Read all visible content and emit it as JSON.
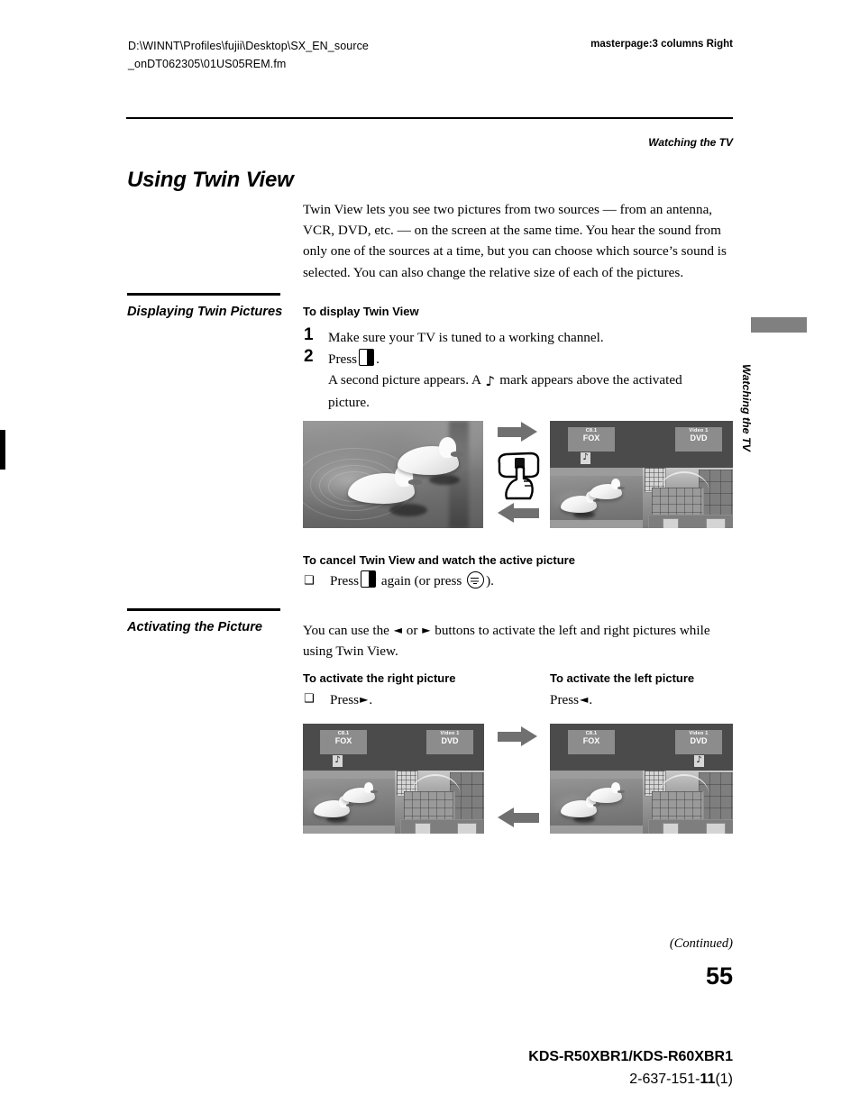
{
  "header": {
    "file_path": "D:\\WINNT\\Profiles\\fujii\\Desktop\\SX_EN_source_onDT062305\\01US05REM.fm",
    "file_path_line1": "D:\\WINNT\\Profiles\\fujii\\Desktop\\SX_EN_source",
    "file_path_line2": "_onDT062305\\01US05REM.fm",
    "masterpage": "masterpage:3 columns Right",
    "running_head": "Watching the TV"
  },
  "title": "Using Twin View",
  "intro": "Twin View lets you see two pictures from two sources — from an antenna, VCR, DVD, etc. — on the screen at the same time. You hear the sound from only one of the sources at a time, but you can choose which source’s sound is selected. You can also change the relative size of each of the pictures.",
  "sections": [
    {
      "heading": "Displaying Twin Pictures",
      "subhead": "To display Twin View",
      "steps": [
        {
          "num": "1",
          "text": "Make sure your TV is tuned to a working channel."
        },
        {
          "num": "2",
          "text_before": "Press",
          "icon": "twin-view-icon",
          "text_after": "."
        }
      ],
      "step_note_before": "A second picture appears. A",
      "step_note_icon": "music-note-icon",
      "step_note_after": "mark appears above the activated picture.",
      "cancel_subhead": "To cancel Twin View and watch the active picture",
      "cancel_bullet": "❑",
      "cancel_before": "Press",
      "cancel_icon": "twin-view-icon",
      "cancel_middle": "again (or press",
      "cancel_icon2": "display-button-icon",
      "cancel_after": ")."
    },
    {
      "heading": "Activating the Picture",
      "body_before": "You can use the",
      "body_arrow_left": "◄",
      "body_or": "or",
      "body_arrow_right": "►",
      "body_after": "buttons to activate the left and right pictures while using Twin View.",
      "left_col": {
        "subhead": "To activate the right picture",
        "bullet": "❑",
        "press": "Press",
        "arrow": "►",
        "period": "."
      },
      "right_col": {
        "subhead": "To activate the left picture",
        "press": "Press",
        "arrow": "◄",
        "period": "."
      }
    }
  ],
  "figures": {
    "figure1": {
      "left_photo_alt": "two-ducks-on-water-photo",
      "arrow_forward": "block-arrow-right",
      "arrow_back": "block-arrow-left",
      "hand": "hand-pressing-button",
      "tv": {
        "left_label_top": "C8.1",
        "left_label_bottom": "FOX",
        "right_label_top": "Video 1",
        "right_label_bottom": "DVD",
        "active_note": "♪",
        "active_side": "left",
        "left_pane_alt": "ducks-thumbnail",
        "right_pane_alt": "building-thumbnail"
      }
    },
    "figure2": {
      "arrow_forward": "block-arrow-right",
      "arrow_back": "block-arrow-left",
      "tv_left": {
        "left_label_top": "C8.1",
        "left_label_bottom": "FOX",
        "right_label_top": "Video 1",
        "right_label_bottom": "DVD",
        "active_note": "♪",
        "active_side": "left"
      },
      "tv_right": {
        "left_label_top": "C8.1",
        "left_label_bottom": "FOX",
        "right_label_top": "Video 1",
        "right_label_bottom": "DVD",
        "active_note": "♪",
        "active_side": "right"
      }
    }
  },
  "side_tab": {
    "label": "Watching the TV"
  },
  "footer": {
    "continued": "(Continued)",
    "page_number": "55",
    "model": "KDS-R50XBR1/KDS-R60XBR1",
    "code_prefix": "2-637-151-",
    "code_bold": "11",
    "code_suffix": "(1)"
  },
  "colors": {
    "tv_background": "#4b4b4b",
    "tv_label": "#8c8c8c",
    "arrow_gray": "#707070",
    "tab_gray": "#808080"
  }
}
